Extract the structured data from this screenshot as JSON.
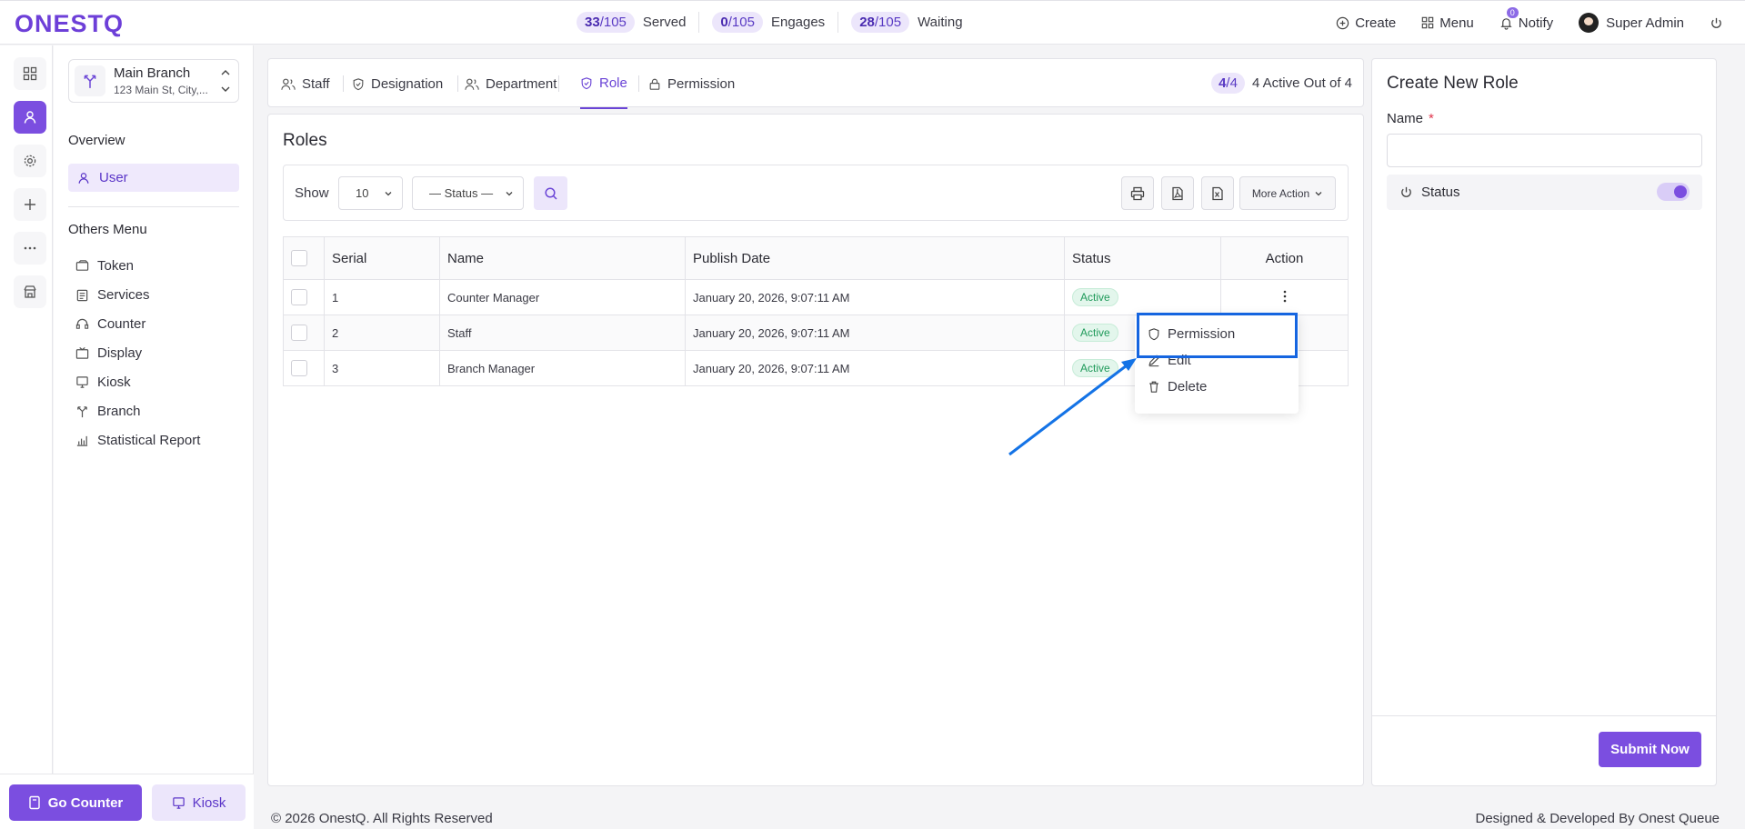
{
  "brand": {
    "logo": "ONESTQ"
  },
  "stats": [
    {
      "count": "33",
      "total": "/105",
      "label": "Served"
    },
    {
      "count": "0",
      "total": "/105",
      "label": "Engages"
    },
    {
      "count": "28",
      "total": "/105",
      "label": "Waiting"
    }
  ],
  "topnav": {
    "create": "Create",
    "menu": "Menu",
    "notify": "Notify",
    "notify_count": "0",
    "user": "Super Admin"
  },
  "branch": {
    "name": "Main Branch",
    "address": "123 Main St, City,..."
  },
  "sidebar": {
    "overview_heading": "Overview",
    "overview_item": "User",
    "others_heading": "Others Menu",
    "items": [
      {
        "label": "Token",
        "icon": "ticket-icon"
      },
      {
        "label": "Services",
        "icon": "clipboard-icon"
      },
      {
        "label": "Counter",
        "icon": "headset-icon"
      },
      {
        "label": "Display",
        "icon": "tv-icon"
      },
      {
        "label": "Kiosk",
        "icon": "kiosk-icon"
      },
      {
        "label": "Branch",
        "icon": "branch-icon"
      },
      {
        "label": "Statistical Report",
        "icon": "chart-icon"
      }
    ]
  },
  "bottom": {
    "go_counter": "Go Counter",
    "kiosk": "Kiosk"
  },
  "tabs": [
    {
      "label": "Staff",
      "active": false
    },
    {
      "label": "Designation",
      "active": false
    },
    {
      "label": "Department",
      "active": false
    },
    {
      "label": "Role",
      "active": true
    },
    {
      "label": "Permission",
      "active": false
    }
  ],
  "active_summary": {
    "pill_count": "4",
    "pill_total": "/4",
    "text": "4 Active Out of 4"
  },
  "roles": {
    "title": "Roles",
    "show_label": "Show",
    "page_size": "10",
    "status_filter": "— Status —",
    "more_action": "More Action",
    "columns": [
      "Serial",
      "Name",
      "Publish Date",
      "Status",
      "Action"
    ],
    "rows": [
      {
        "serial": "1",
        "name": "Counter Manager",
        "date": "January 20, 2026, 9:07:11 AM",
        "status": "Active"
      },
      {
        "serial": "2",
        "name": "Staff",
        "date": "January 20, 2026, 9:07:11 AM",
        "status": "Active"
      },
      {
        "serial": "3",
        "name": "Branch Manager",
        "date": "January 20, 2026, 9:07:11 AM",
        "status": "Active"
      }
    ]
  },
  "dropdown": {
    "permission": "Permission",
    "edit": "Edit",
    "delete": "Delete"
  },
  "create_role": {
    "title": "Create New Role",
    "name_label": "Name",
    "required_mark": "*",
    "status_label": "Status",
    "status_on": true,
    "submit": "Submit Now"
  },
  "footer": {
    "left": "© 2026 OnestQ. All Rights Reserved",
    "right": "Designed & Developed By Onest Queue"
  },
  "colors": {
    "accent": "#7b4ee0",
    "highlight": "#1565e0",
    "active_green": "#1f9a5a"
  }
}
